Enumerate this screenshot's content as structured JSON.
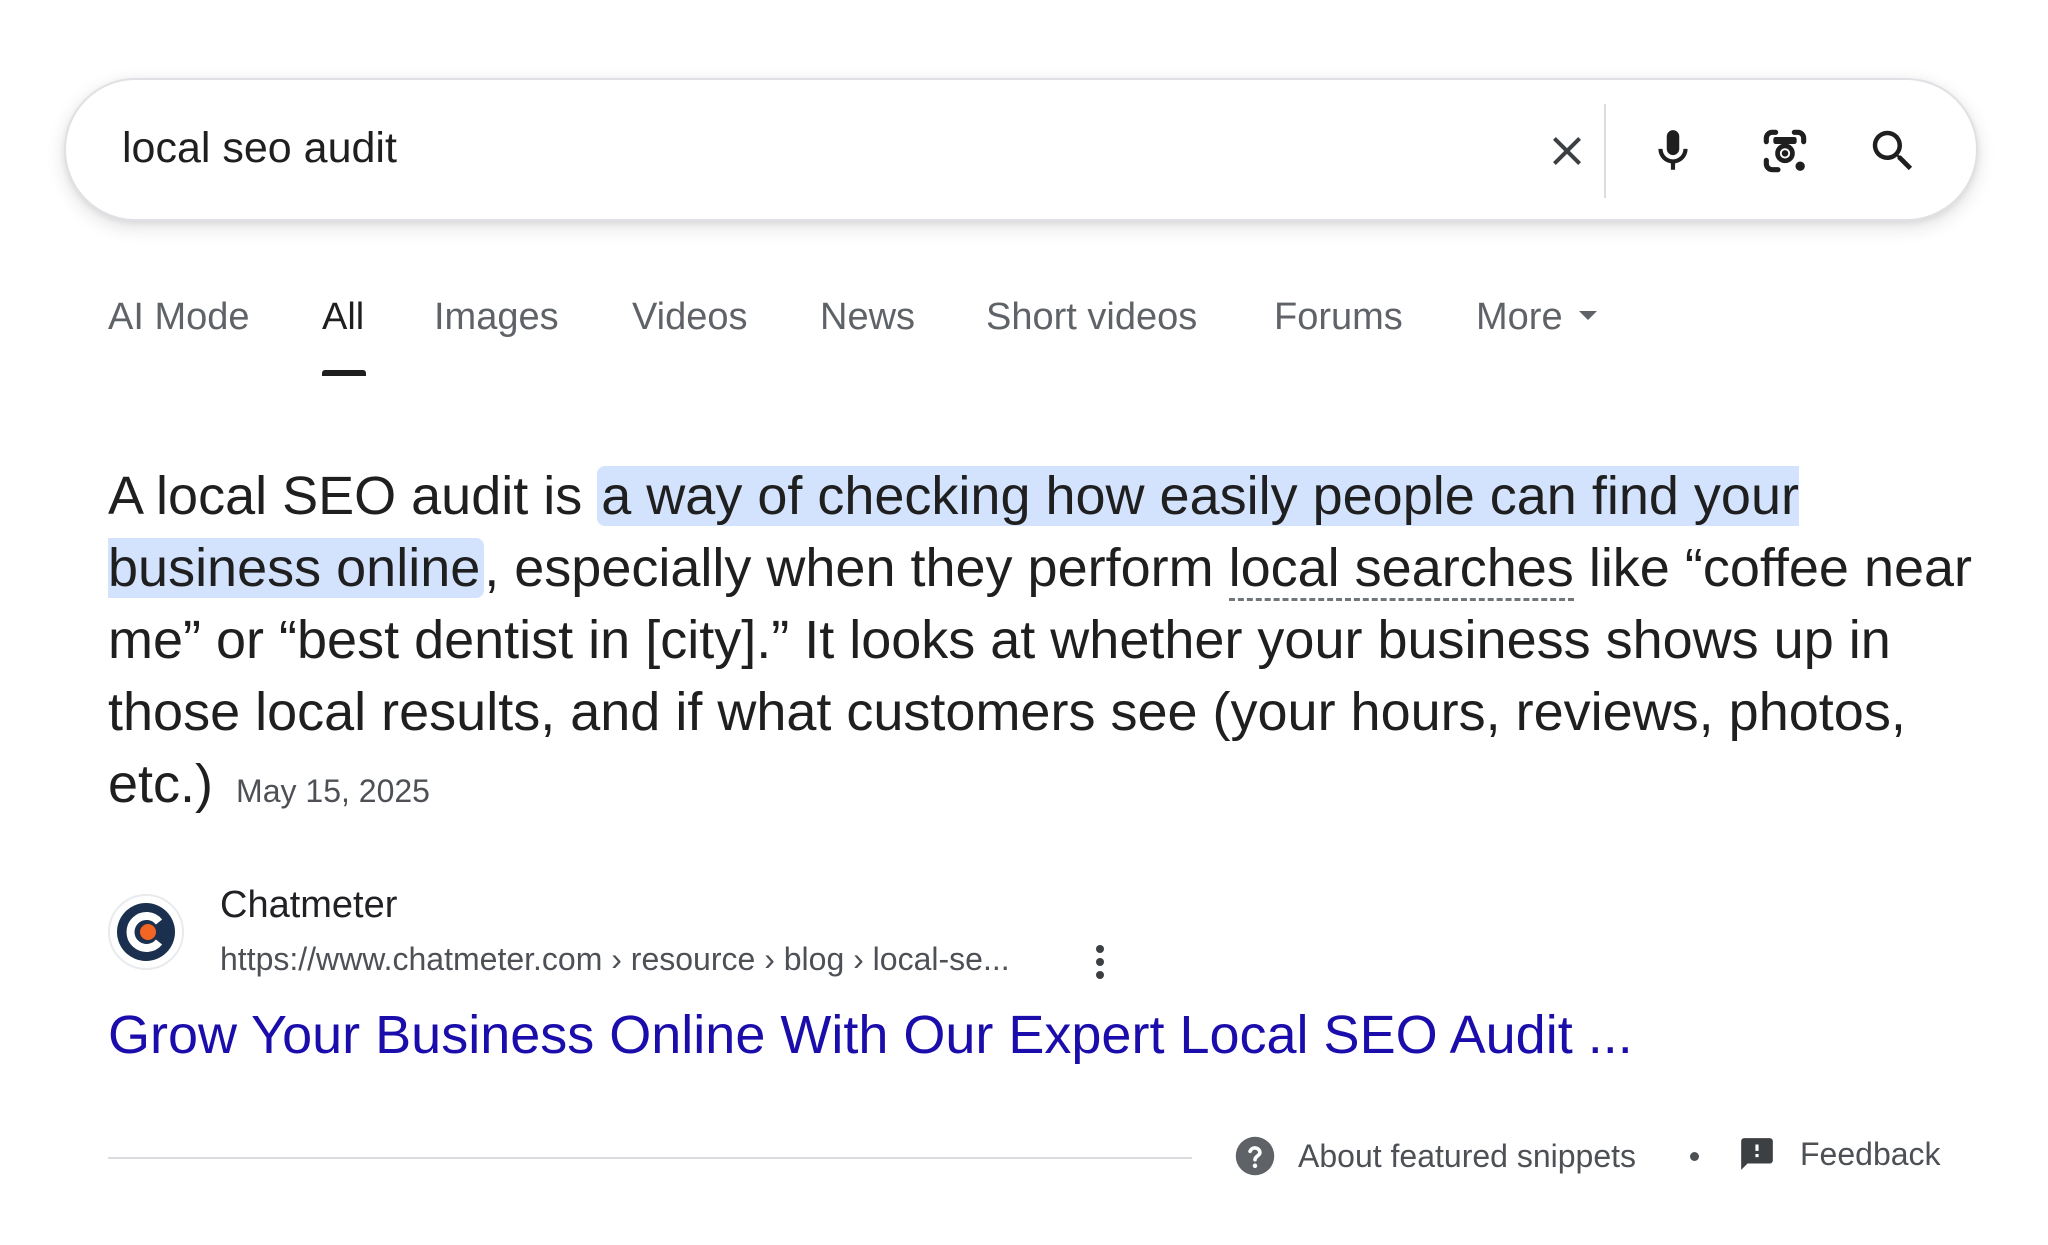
{
  "search": {
    "query": "local seo audit"
  },
  "tabs": [
    {
      "label": "AI Mode",
      "active": false
    },
    {
      "label": "All",
      "active": true
    },
    {
      "label": "Images",
      "active": false
    },
    {
      "label": "Videos",
      "active": false
    },
    {
      "label": "News",
      "active": false
    },
    {
      "label": "Short videos",
      "active": false
    },
    {
      "label": "Forums",
      "active": false
    },
    {
      "label": "More",
      "active": false
    }
  ],
  "snippet": {
    "lead": "A local SEO audit is ",
    "highlight": "a way of checking how easily people can find your business online",
    "middle": ", especially when they perform ",
    "term": "local searches",
    "rest": " like “coffee near me” or “best dentist in [city].” It looks at whether your business shows up in those local results, and if what customers see (your hours, reviews, photos, etc.)",
    "date": "May 15, 2025"
  },
  "source": {
    "name": "Chatmeter",
    "url": "https://www.chatmeter.com › resource › blog › local-se...",
    "title": "Grow Your Business Online With Our Expert Local SEO Audit ...",
    "favicon_colors": {
      "ring": "#1b2f4e",
      "dot": "#f26522"
    }
  },
  "footer": {
    "about": "About featured snippets",
    "feedback": "Feedback"
  },
  "colors": {
    "link": "#1a0dab",
    "highlight": "#d3e3fd",
    "muted": "#5f6368"
  }
}
